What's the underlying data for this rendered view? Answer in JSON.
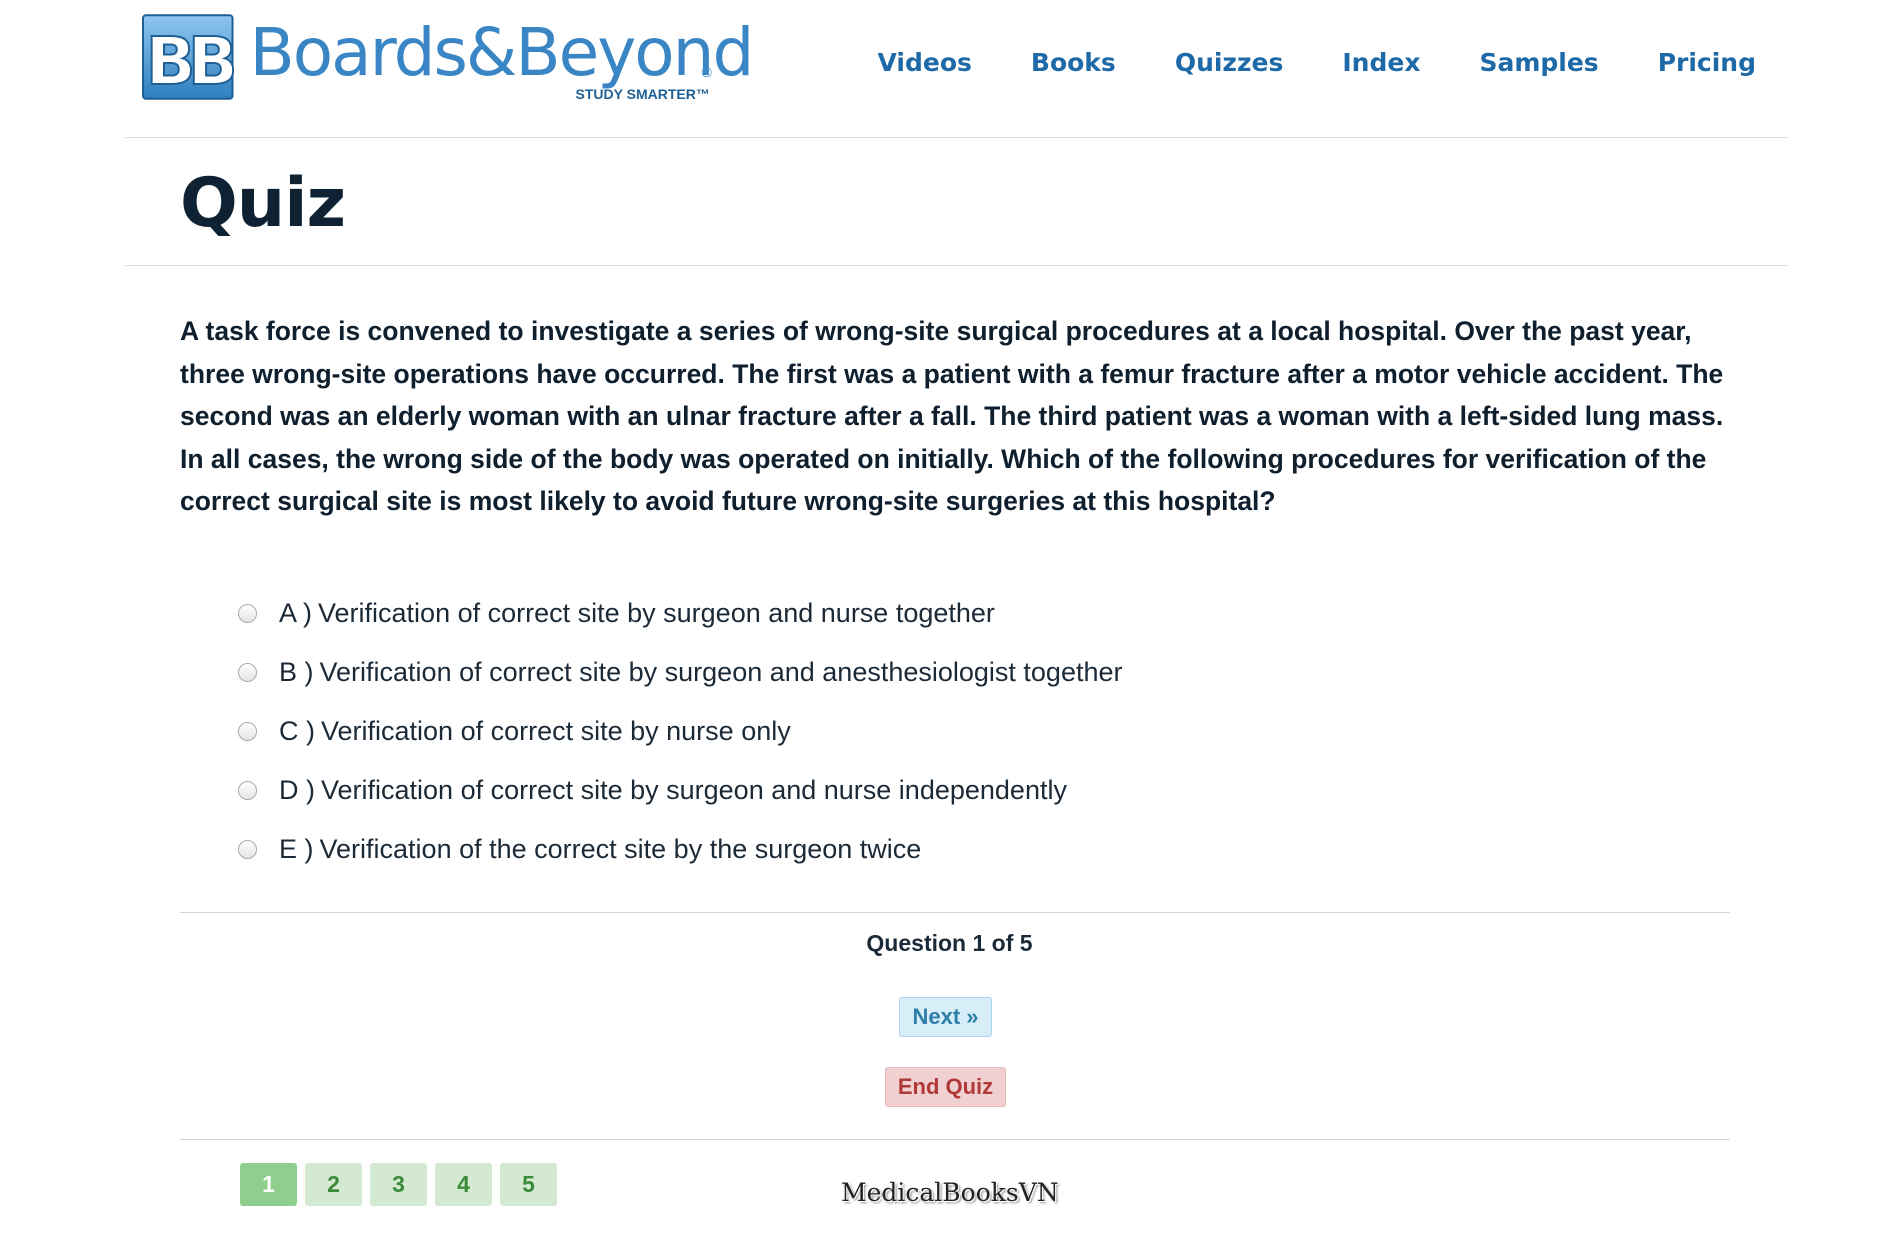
{
  "header": {
    "logo": {
      "brand": "Boards&Beyond",
      "registered": "®",
      "tagline": "STUDY SMARTER™"
    },
    "nav": [
      {
        "label": "Videos"
      },
      {
        "label": "Books"
      },
      {
        "label": "Quizzes"
      },
      {
        "label": "Index"
      },
      {
        "label": "Samples"
      },
      {
        "label": "Pricing"
      }
    ]
  },
  "page": {
    "title": "Quiz"
  },
  "quiz": {
    "question": "A task force is convened to investigate a series of wrong-site surgical procedures at a local hospital. Over the past year, three wrong-site operations have occurred. The first was a patient with a femur fracture after a motor vehicle accident. The second was an elderly woman with an ulnar fracture after a fall. The third patient was a woman with a left-sided lung mass. In all cases, the wrong side of the body was operated on initially. Which of the following procedures for verification of the correct surgical site is most likely to avoid future wrong-site surgeries at this hospital?",
    "answers": [
      {
        "letter": "A )",
        "text": "Verification of correct site by surgeon and nurse together"
      },
      {
        "letter": "B )",
        "text": "Verification of correct site by surgeon and anesthesiologist together"
      },
      {
        "letter": "C )",
        "text": "Verification of correct site by nurse only"
      },
      {
        "letter": "D )",
        "text": "Verification of correct site by surgeon and nurse independently"
      },
      {
        "letter": "E )",
        "text": "Verification of the correct site by the surgeon twice"
      }
    ],
    "selected": null,
    "progress": "Question 1 of 5",
    "next_label": "Next »",
    "end_label": "End Quiz",
    "pages": [
      "1",
      "2",
      "3",
      "4",
      "5"
    ],
    "current_page": "1"
  },
  "watermark": "MedicalBooksVN",
  "colors": {
    "brand_blue": "#3a86c4",
    "nav_blue": "#1e6aa8",
    "next_bg": "#d7eef8",
    "end_bg": "#f0d0d0",
    "page_active": "#8fcf8e",
    "page_inactive": "#d3e9d1"
  }
}
